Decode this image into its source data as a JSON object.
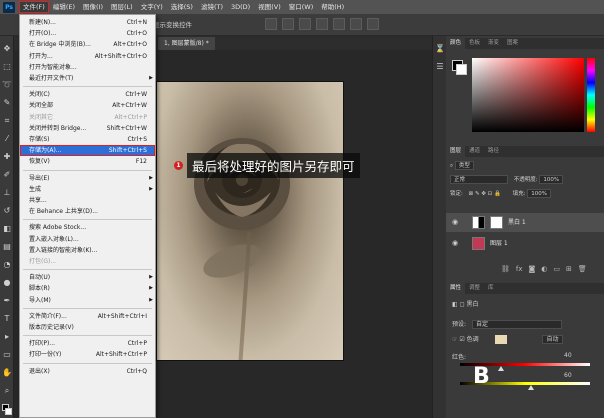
{
  "app": {
    "logo": "Ps"
  },
  "menubar": {
    "items": [
      "文件(F)",
      "编辑(E)",
      "图像(I)",
      "图层(L)",
      "文字(Y)",
      "选择(S)",
      "滤镜(T)",
      "3D(D)",
      "视图(V)",
      "窗口(W)",
      "帮助(H)"
    ]
  },
  "options": {
    "label": "显示变换控件"
  },
  "document": {
    "tab": "1, 图层蒙版/8) *"
  },
  "annotation": {
    "number": "1",
    "text": "最后将处理好的图片另存即可"
  },
  "file_menu": {
    "rows": [
      {
        "label": "新建(N)...",
        "shortcut": "Ctrl+N"
      },
      {
        "label": "打开(O)...",
        "shortcut": "Ctrl+O"
      },
      {
        "label": "在 Bridge 中浏览(B)...",
        "shortcut": "Alt+Ctrl+O"
      },
      {
        "label": "打开为...",
        "shortcut": "Alt+Shift+Ctrl+O"
      },
      {
        "label": "打开为智能对象...",
        "shortcut": ""
      },
      {
        "label": "最近打开文件(T)",
        "shortcut": "",
        "submenu": true
      },
      {
        "sep": true
      },
      {
        "label": "关闭(C)",
        "shortcut": "Ctrl+W"
      },
      {
        "label": "关闭全部",
        "shortcut": "Alt+Ctrl+W"
      },
      {
        "label": "关闭其它",
        "shortcut": "Alt+Ctrl+P",
        "disabled": true
      },
      {
        "label": "关闭并转到 Bridge...",
        "shortcut": "Shift+Ctrl+W"
      },
      {
        "label": "存储(S)",
        "shortcut": "Ctrl+S"
      },
      {
        "label": "存储为(A)...",
        "shortcut": "Shift+Ctrl+S",
        "selected": true
      },
      {
        "label": "恢复(V)",
        "shortcut": "F12"
      },
      {
        "sep": true
      },
      {
        "label": "导出(E)",
        "shortcut": "",
        "submenu": true
      },
      {
        "label": "生成",
        "shortcut": "",
        "submenu": true
      },
      {
        "label": "共享...",
        "shortcut": ""
      },
      {
        "label": "在 Behance 上共享(D)...",
        "shortcut": ""
      },
      {
        "sep": true
      },
      {
        "label": "搜索 Adobe Stock...",
        "shortcut": ""
      },
      {
        "label": "置入嵌入对象(L)...",
        "shortcut": ""
      },
      {
        "label": "置入链接的智能对象(K)...",
        "shortcut": ""
      },
      {
        "label": "打包(G)...",
        "shortcut": "",
        "disabled": true
      },
      {
        "sep": true
      },
      {
        "label": "自动(U)",
        "shortcut": "",
        "submenu": true
      },
      {
        "label": "脚本(R)",
        "shortcut": "",
        "submenu": true
      },
      {
        "label": "导入(M)",
        "shortcut": "",
        "submenu": true
      },
      {
        "sep": true
      },
      {
        "label": "文件简介(F)...",
        "shortcut": "Alt+Shift+Ctrl+I"
      },
      {
        "label": "版本历史记录(V)",
        "shortcut": ""
      },
      {
        "sep": true
      },
      {
        "label": "打印(P)...",
        "shortcut": "Ctrl+P"
      },
      {
        "label": "打印一份(Y)",
        "shortcut": "Alt+Shift+Ctrl+P"
      },
      {
        "sep": true
      },
      {
        "label": "退出(X)",
        "shortcut": "Ctrl+Q"
      }
    ]
  },
  "color_panel": {
    "tabs": [
      "颜色",
      "色板",
      "渐变",
      "图案"
    ]
  },
  "layers_panel": {
    "tabs": [
      "图层",
      "通道",
      "路径"
    ],
    "kind": "类型",
    "blend_mode": "正常",
    "opacity_label": "不透明度:",
    "opacity": "100%",
    "lock_label": "锁定:",
    "fill_label": "填充:",
    "fill": "100%",
    "layers": [
      {
        "name": "黑白 1",
        "selected": true
      },
      {
        "name": "图层 1",
        "selected": false
      }
    ]
  },
  "properties_panel": {
    "tabs": [
      "属性",
      "调整",
      "库"
    ],
    "title": "黑白",
    "preset_label": "预设:",
    "preset_value": "自定",
    "tint_label": "色调",
    "auto_label": "自动",
    "reds_label": "红色:",
    "reds_value": "40",
    "yellows_value": "60",
    "tint_color": "#e9d8b4"
  },
  "colors": {
    "accent": "#2d6fd6",
    "highlight": "#e02020"
  }
}
